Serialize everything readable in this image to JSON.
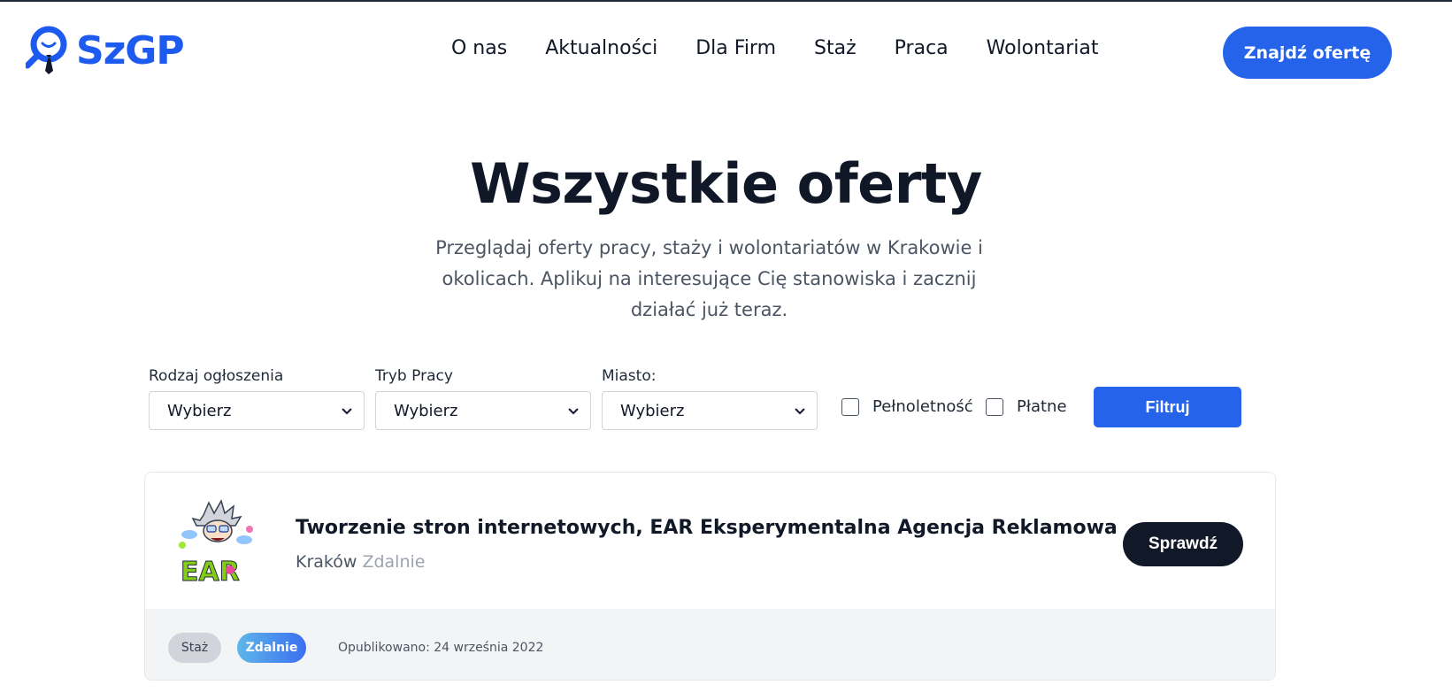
{
  "header": {
    "logo_text": "SzGP",
    "nav": [
      "O nas",
      "Aktualności",
      "Dla Firm",
      "Staż",
      "Praca",
      "Wolontariat"
    ],
    "cta_label": "Znajdź ofertę"
  },
  "hero": {
    "title": "Wszystkie oferty",
    "subtitle": "Przeglądaj oferty pracy, staży i wolontariatów w Krakowie i okolicach. Aplikuj na interesujące Cię stanowiska i zacznij działać już teraz."
  },
  "filters": {
    "type_label": "Rodzaj ogłoszenia",
    "type_value": "Wybierz",
    "mode_label": "Tryb Pracy",
    "mode_value": "Wybierz",
    "city_label": "Miasto:",
    "city_value": "Wybierz",
    "adult_label": "Pełnoletność",
    "paid_label": "Płatne",
    "adult_checked": false,
    "paid_checked": false,
    "submit_label": "Filtruj"
  },
  "offers": [
    {
      "title": "Tworzenie stron internetowych, EAR Eksperymentalna Agencja Reklamowa",
      "city": "Kraków",
      "mode": "Zdalnie",
      "action_label": "Sprawdź",
      "tags": [
        "Staż",
        "Zdalnie"
      ],
      "published": "Opublikowano: 24 września 2022",
      "logo_text": "EAR"
    }
  ],
  "colors": {
    "brand": "#1d5bf0",
    "primary": "#2563eb",
    "dark": "#111827"
  }
}
